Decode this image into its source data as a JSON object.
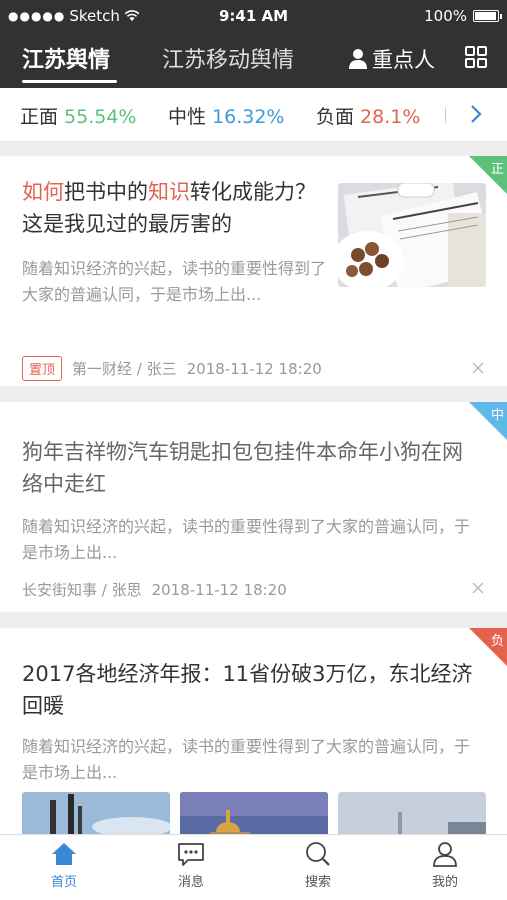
{
  "status_bar": {
    "carrier": "Sketch",
    "time": "9:41 AM",
    "battery": "100%"
  },
  "tabs": [
    {
      "label": "江苏舆情",
      "active": true
    },
    {
      "label": "江苏移动舆情",
      "active": false
    }
  ],
  "key_person_label": "重点人",
  "sentiment": {
    "positive": {
      "label": "正面",
      "value": "55.54%",
      "color": "#5cc27a"
    },
    "neutral": {
      "label": "中性",
      "value": "16.32%",
      "color": "#3b9bde"
    },
    "negative": {
      "label": "负面",
      "value": "28.1%",
      "color": "#e5624f"
    }
  },
  "articles": [
    {
      "badge": "正",
      "badge_color": "#5cc27a",
      "title_parts": [
        "如何",
        "把书中的",
        "知识",
        "转化成能力？这是我见过的最厉害的"
      ],
      "desc": "随着知识经济的兴起，读书的重要性得到了大家的普遍认同，于是市场上出...",
      "pinned_label": "置顶",
      "source": "第一财经 / 张三",
      "time": "2018-11-12 18:20"
    },
    {
      "badge": "中",
      "badge_color": "#5fb8e8",
      "title": "狗年吉祥物汽车钥匙扣包包挂件本命年小狗在网络中走红",
      "desc": "随着知识经济的兴起，读书的重要性得到了大家的普遍认同，于是市场上出...",
      "source": "长安街知事 / 张思",
      "time": "2018-11-12 18:20"
    },
    {
      "badge": "负",
      "badge_color": "#e5624f",
      "title": "2017各地经济年报：11省份破3万亿，东北经济回暖",
      "desc": "随着知识经济的兴起，读书的重要性得到了大家的普遍认同，于是市场上出..."
    }
  ],
  "nav": [
    {
      "label": "首页",
      "icon": "home-icon",
      "active": true
    },
    {
      "label": "消息",
      "icon": "message-icon",
      "active": false
    },
    {
      "label": "搜索",
      "icon": "search-icon",
      "active": false
    },
    {
      "label": "我的",
      "icon": "profile-icon",
      "active": false
    }
  ]
}
